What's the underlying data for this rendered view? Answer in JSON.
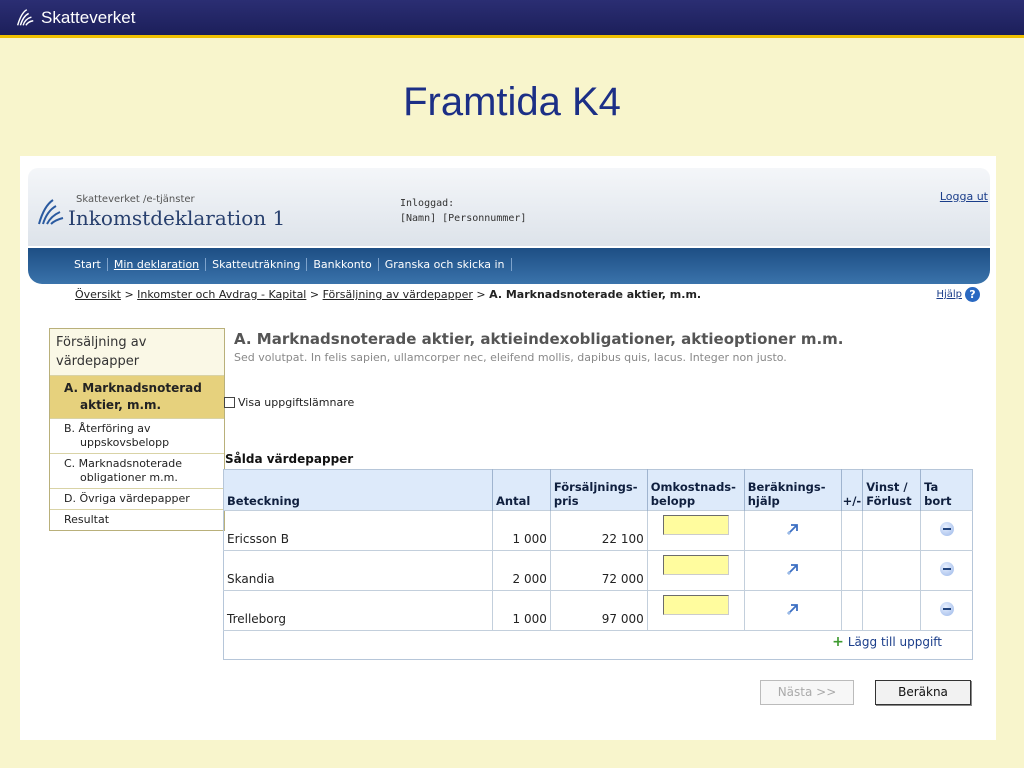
{
  "header": {
    "brand": "Skatteverket"
  },
  "slide": {
    "title": "Framtida K4"
  },
  "app": {
    "portal": "Skatteverket /e-tjänster",
    "name": "Inkomstdeklaration 1",
    "logged_in_label": "Inloggad:",
    "logged_in_value": "[Namn] [Personnummer]",
    "logout": "Logga ut"
  },
  "nav": {
    "items": [
      "Start",
      "Min deklaration",
      "Skatteuträkning",
      "Bankkonto",
      "Granska och skicka in"
    ],
    "active": "Min deklaration"
  },
  "breadcrumb": {
    "links": [
      "Översikt",
      "Inkomster och Avdrag - Kapital",
      "Försäljning av värdepapper"
    ],
    "separator": ">",
    "current": "A. Marknadsnoterade aktier, m.m."
  },
  "help": {
    "label": "Hjälp",
    "icon": "help-icon"
  },
  "sidemenu": {
    "head": "Försäljning av värdepapper",
    "items": [
      {
        "line1": "A. Marknadsnoterad",
        "line2": "aktier, m.m."
      },
      {
        "line1": "B. Återföring av",
        "line2": "uppskovsbelopp"
      },
      {
        "line1": "C. Marknadsnoterade",
        "line2": "obligationer m.m."
      },
      {
        "line1": "D. Övriga värdepapper",
        "line2": ""
      },
      {
        "line1": "Resultat",
        "line2": ""
      }
    ]
  },
  "content": {
    "title": "A. Marknadsnoterade aktier, aktieindexobligationer, aktieoptioner  m.m.",
    "subtitle": "Sed volutpat. In felis sapien, ullamcorper nec, eleifend mollis, dapibus quis, lacus. Integer non justo.",
    "checkbox_label": "Visa uppgiftslämnare",
    "section_title": "Sålda värdepapper"
  },
  "table": {
    "headers": [
      "Beteckning",
      "Antal",
      "Försäljnings-\npris",
      "Omkostnads-\nbelopp",
      "Beräknings-\nhjälp",
      "+/-",
      "Vinst /\nFörlust",
      "Ta bort"
    ],
    "rows": [
      {
        "beteckning": "Ericsson B",
        "antal": "1 000",
        "pris": "22 100"
      },
      {
        "beteckning": "Skandia",
        "antal": "2 000",
        "pris": "72 000"
      },
      {
        "beteckning": "Trelleborg",
        "antal": "1 000",
        "pris": "97 000"
      }
    ],
    "add_label": "Lägg till uppgift"
  },
  "buttons": {
    "next": "Nästa >>",
    "calculate": "Beräkna"
  },
  "colors": {
    "slide_bg": "#f8f5cc",
    "title": "#1c2f86",
    "nav": "#2a5f96",
    "active_menu": "#e6d17d",
    "input_bg": "#fffc9e"
  }
}
